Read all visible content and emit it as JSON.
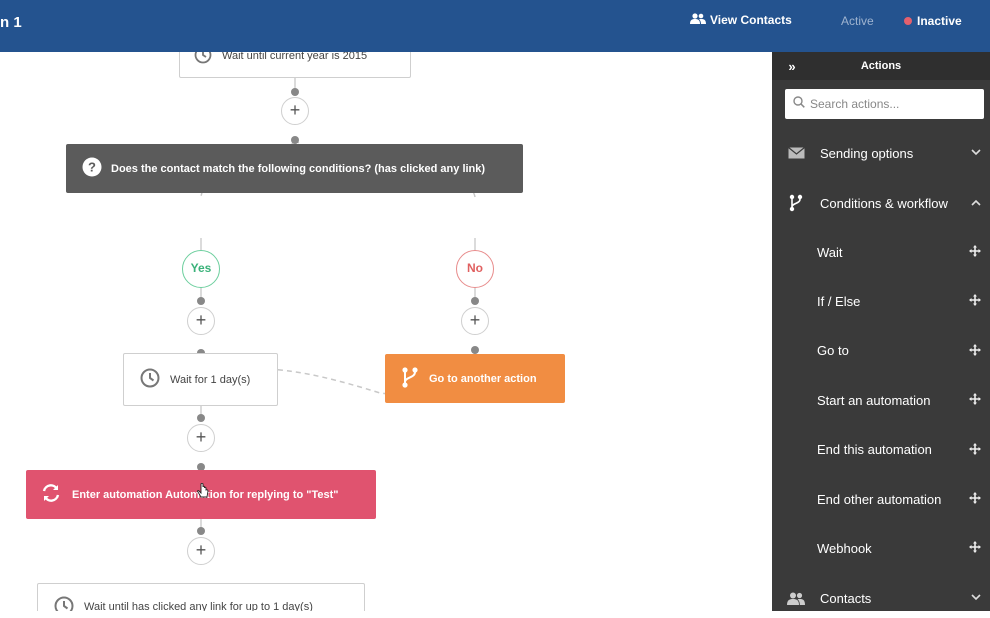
{
  "header": {
    "title": "n 1",
    "view_contacts": "View Contacts",
    "status_active": "Active",
    "status_inactive": "Inactive"
  },
  "workflow": {
    "top_wait": "Wait until current year is 2015",
    "condition": "Does the contact match the following conditions? (has clicked any link)",
    "yes_label": "Yes",
    "no_label": "No",
    "wait_1_day": "Wait for 1 day(s)",
    "go_to_action": "Go to another action",
    "enter_automation": "Enter automation Automation for replying to \"Test\"",
    "bottom_wait": "Wait until has clicked any link for up to 1 day(s)",
    "plus": "+"
  },
  "sidebar": {
    "title": "Actions",
    "toggle": "»",
    "search_placeholder": "Search actions...",
    "groups": [
      {
        "label": "Sending options",
        "icon": "envelope-icon",
        "expanded": false
      },
      {
        "label": "Conditions & workflow",
        "icon": "branch-icon",
        "expanded": true
      },
      {
        "label": "Contacts",
        "icon": "contacts-icon",
        "expanded": false
      }
    ],
    "workflow_items": [
      "Wait",
      "If / Else",
      "Go to",
      "Start an automation",
      "End this automation",
      "End other automation",
      "Webhook"
    ]
  },
  "colors": {
    "header": "#24538f",
    "sidebar": "#3a3a3a",
    "condition_node": "#5b5b5b",
    "goto_node": "#f18d42",
    "automation_node": "#e0536f",
    "yes": "#3bb27a",
    "no": "#e06060",
    "inactive_dot": "#e4606d"
  }
}
